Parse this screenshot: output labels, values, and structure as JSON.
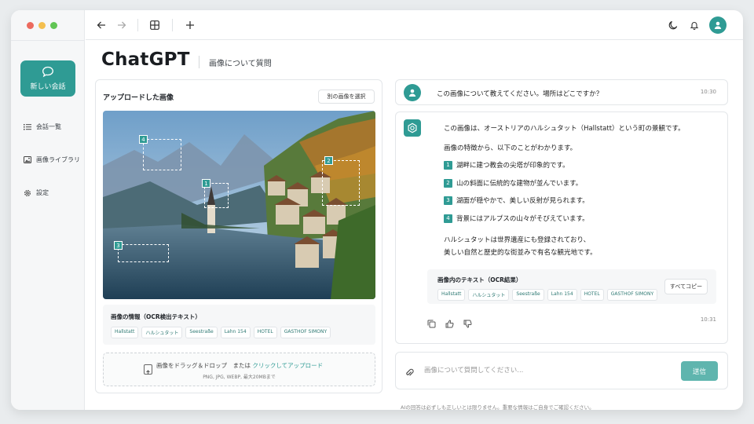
{
  "app": {
    "title": "ChatGPT",
    "subtitle": "画像について質問"
  },
  "colors": {
    "accent": "#2f9b94",
    "send": "#5fb5ae",
    "traffic_red": "#ec6a5e",
    "traffic_yellow": "#f4bf4f",
    "traffic_green": "#61c554"
  },
  "sidebar": {
    "new_chat_label": "新しい会話",
    "items": [
      {
        "label": "会話一覧",
        "icon": "list-icon"
      },
      {
        "label": "画像ライブラリ",
        "icon": "image-icon"
      },
      {
        "label": "設定",
        "icon": "gear-icon"
      }
    ]
  },
  "left_panel": {
    "title": "アップロードした画像",
    "select_button": "別の画像を選択",
    "markers": [
      "1",
      "2",
      "3",
      "4"
    ],
    "info_title": "画像の情報（OCR検出テキスト）",
    "ocr_tags": [
      "Hallstatt",
      "ハルシュタット",
      "Seestraße",
      "Lahn 154",
      "HOTEL",
      "GASTHOF SIMONY"
    ],
    "upload_text": "画像をドラッグ＆ドロップ　または",
    "upload_link": "クリックしてアップロード",
    "upload_hint": "PNG, JPG, WEBP, 最大20MBまで"
  },
  "chat": {
    "user_message": "この画像について教えてください。場所はどこですか？",
    "user_time": "10:30",
    "bot_intro": "この画像は、オーストリアのハルシュタット（Hallstatt）という町の景観です。",
    "bot_lead": "画像の特徴から、以下のことがわかります。",
    "bot_points": [
      {
        "n": "1",
        "text": "湖畔に建つ教会の尖塔が印象的です。"
      },
      {
        "n": "2",
        "text": "山の斜面に伝統的な建物が並んでいます。"
      },
      {
        "n": "3",
        "text": "湖面が穏やかで、美しい反射が見られます。"
      },
      {
        "n": "4",
        "text": "背景にはアルプスの山々がそびえています。"
      }
    ],
    "bot_outro_1": "ハルシュタットは世界遺産にも登録されており、",
    "bot_outro_2": "美しい自然と歴史的な街並みで有名な観光地です。",
    "ocr_title": "画像内のテキスト（OCR結果）",
    "copy_all": "すべてコピー",
    "ocr_tags": [
      "Hallstatt",
      "ハルシュタット",
      "Seestraße",
      "Lahn 154",
      "HOTEL",
      "GASTHOF SIMONY"
    ],
    "bot_time": "10:31"
  },
  "input": {
    "placeholder": "画像について質問してください...",
    "send_label": "送信"
  },
  "footer": {
    "disclaimer": "AIの回答は必ずしも正しいとは限りません。重要な情報はご自身でご確認ください。"
  }
}
